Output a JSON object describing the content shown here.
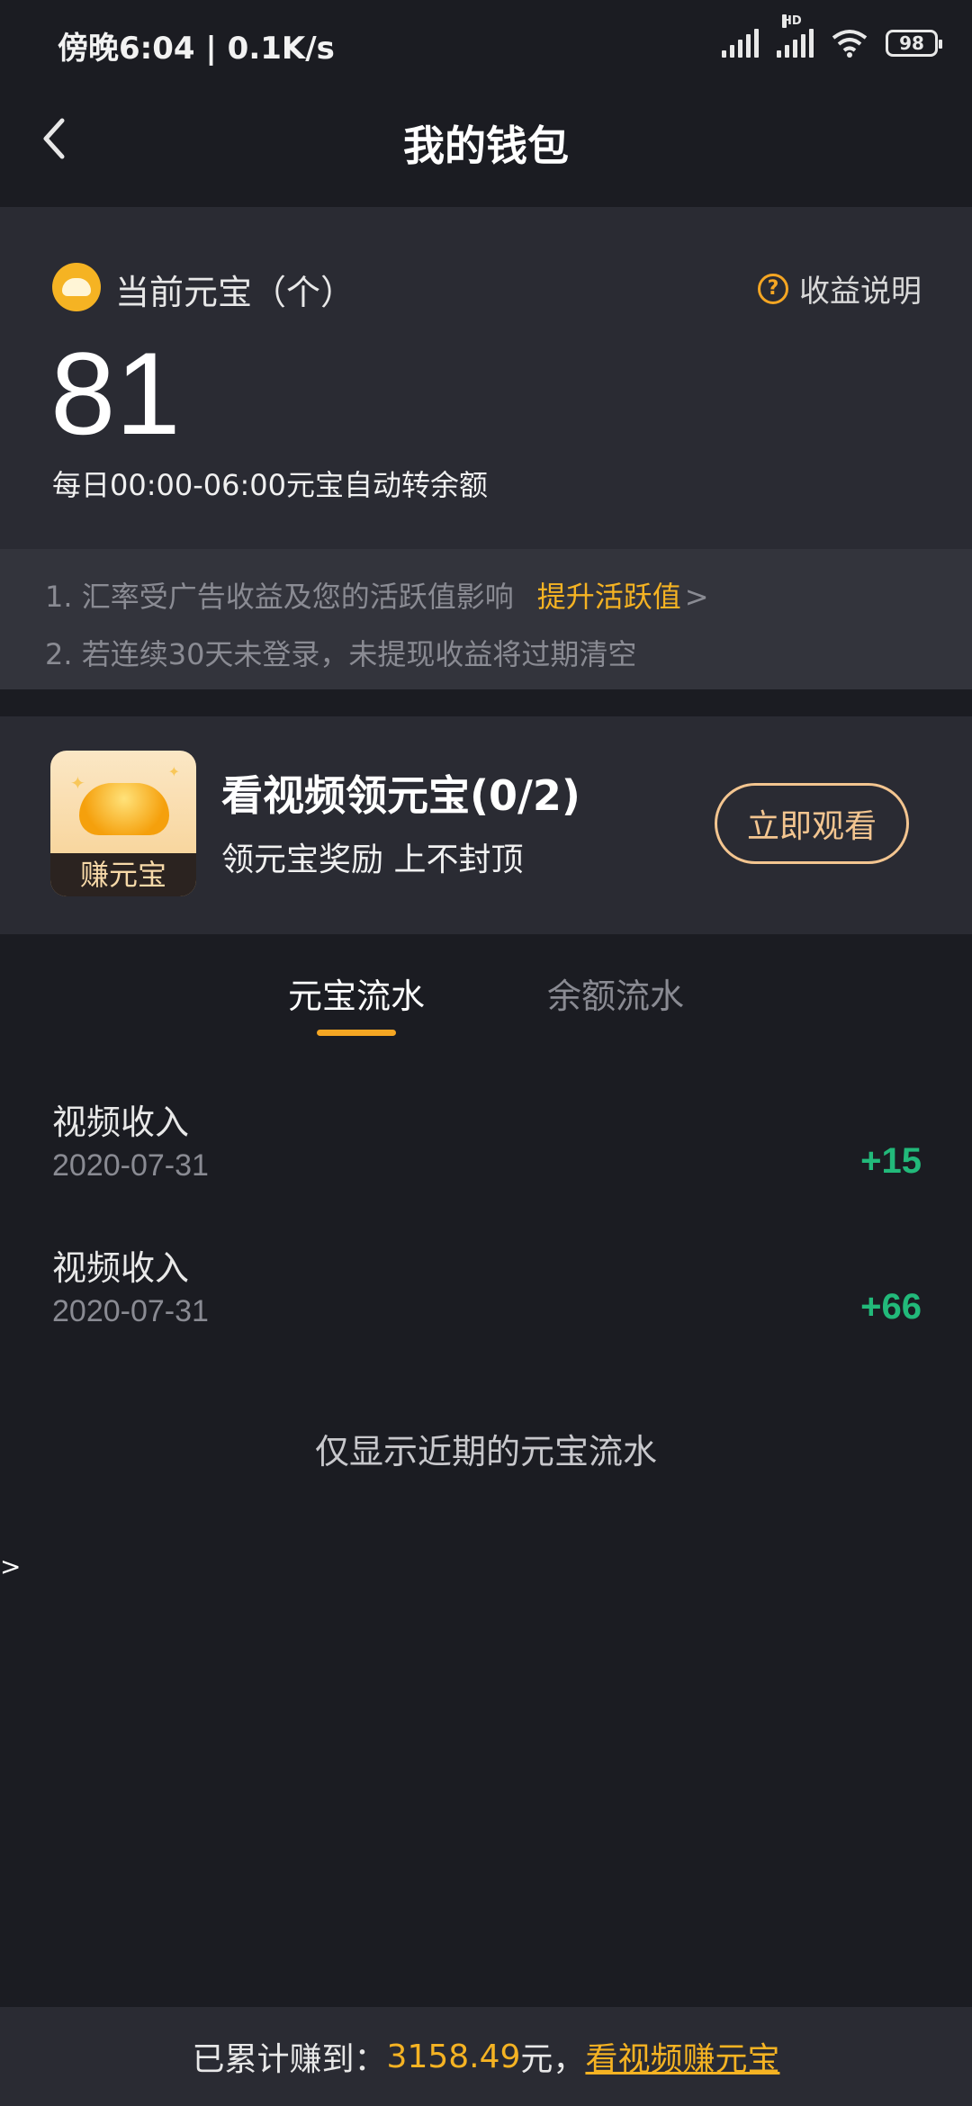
{
  "status_bar": {
    "time": "傍晚6:04 | 0.1K/s",
    "hd_label": "HD",
    "battery": "98"
  },
  "header": {
    "title": "我的钱包",
    "back_icon": "chevron-left-icon"
  },
  "balance": {
    "label": "当前元宝（个）",
    "explain_label": "收益说明",
    "explain_icon": "?",
    "value": "81",
    "note": "每日00:00-06:00元宝自动转余额"
  },
  "notes": {
    "line1": "1. 汇率受广告收益及您的活跃值影响",
    "boost_link": "提升活跃值",
    "boost_arrow": ">",
    "line2": "2. 若连续30天未登录，未提现收益将过期清空"
  },
  "task": {
    "thumb_label": "赚元宝",
    "title": "看视频领元宝(0/2)",
    "subtitle": "领元宝奖励 上不封顶",
    "button": "立即观看"
  },
  "tabs": [
    {
      "label": "元宝流水",
      "active": true
    },
    {
      "label": "余额流水",
      "active": false
    }
  ],
  "records": [
    {
      "title": "视频收入",
      "date": "2020-07-31",
      "amount": "+15"
    },
    {
      "title": "视频收入",
      "date": "2020-07-31",
      "amount": "+66"
    }
  ],
  "recent_note": "仅显示近期的元宝流水",
  "stray_text": ">",
  "footer": {
    "prefix": "已累计赚到：",
    "amount": "3158.49",
    "unit": "元，",
    "link": "看视频赚元宝"
  },
  "colors": {
    "background": "#1b1c22",
    "card": "#2a2b33",
    "accent": "#f5a623",
    "income": "#22b97a"
  }
}
